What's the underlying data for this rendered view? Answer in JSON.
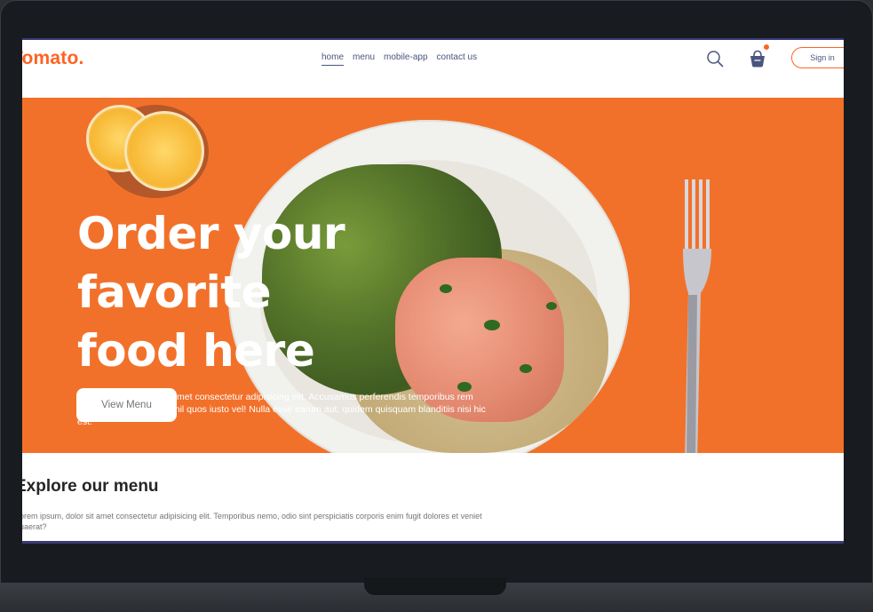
{
  "navbar": {
    "logo": "Tomato.",
    "links": [
      {
        "label": "home",
        "active": true
      },
      {
        "label": "menu",
        "active": false
      },
      {
        "label": "mobile-app",
        "active": false
      },
      {
        "label": "contact us",
        "active": false
      }
    ],
    "search_icon": "search-icon",
    "basket_icon": "basket-icon",
    "signin_label": "Sign in"
  },
  "hero": {
    "title_line1": "Order your favorite",
    "title_line2": "food here",
    "text": "Lorem, ipsum dolor sit amet consectetur adipisicing elit. Accusamus perferendis temporibus rem deleniti est veniam at nihil quos iusto vel! Nulla esse earum aut, quidem quisquam blanditiis nisi hic est.",
    "button_label": "View Menu"
  },
  "explore": {
    "title": "Explore our menu",
    "text": "Lorem ipsum, dolor sit amet consectetur adipisicing elit. Temporibus nemo, odio sint perspiciatis corporis enim fugit dolores et veniet quaerat?"
  },
  "colors": {
    "brand": "#ff6323",
    "hero_bg": "#f2712a",
    "nav_text": "#49557e"
  }
}
